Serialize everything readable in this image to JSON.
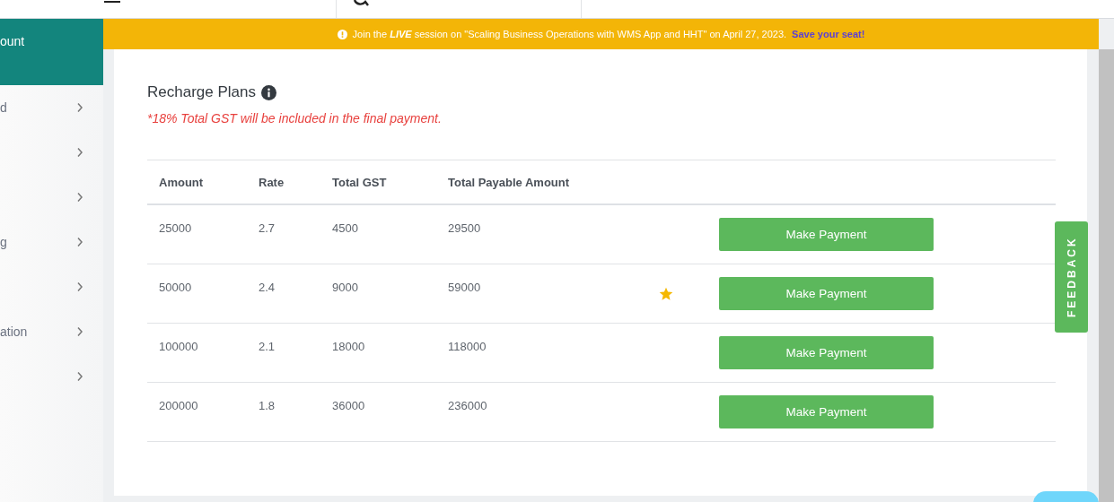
{
  "sidebar": {
    "items": [
      {
        "label": "ount",
        "selected": true
      },
      {
        "label": "d",
        "selected": false
      },
      {
        "selected": false
      },
      {
        "selected": false
      },
      {
        "label": "g",
        "selected": false
      },
      {
        "selected": false
      },
      {
        "label": "ation",
        "selected": false
      },
      {
        "selected": false
      }
    ]
  },
  "banner": {
    "lead": "Join the **LIVE** session on \"Scaling Business Operations with WMS App and HHT\" on April 27, 2023.",
    "link": "Save your seat!"
  },
  "plans": {
    "title": "Recharge Plans",
    "note": "*18% Total GST will be included in the final payment.",
    "columns": [
      "Amount",
      "Rate",
      "Total GST",
      "Total Payable Amount"
    ],
    "rows": [
      {
        "cells": [
          "25000",
          "2.7",
          "4500",
          "29500"
        ],
        "featured": false,
        "action": "Make Payment"
      },
      {
        "cells": [
          "50000",
          "2.4",
          "9000",
          "59000"
        ],
        "featured": true,
        "action": "Make Payment"
      },
      {
        "cells": [
          "100000",
          "2.1",
          "18000",
          "118000"
        ],
        "featured": false,
        "action": "Make Payment"
      },
      {
        "cells": [
          "200000",
          "1.8",
          "36000",
          "236000"
        ],
        "featured": false,
        "action": "Make Payment"
      }
    ]
  },
  "feedback": {
    "label": "FEEDBACK"
  }
}
